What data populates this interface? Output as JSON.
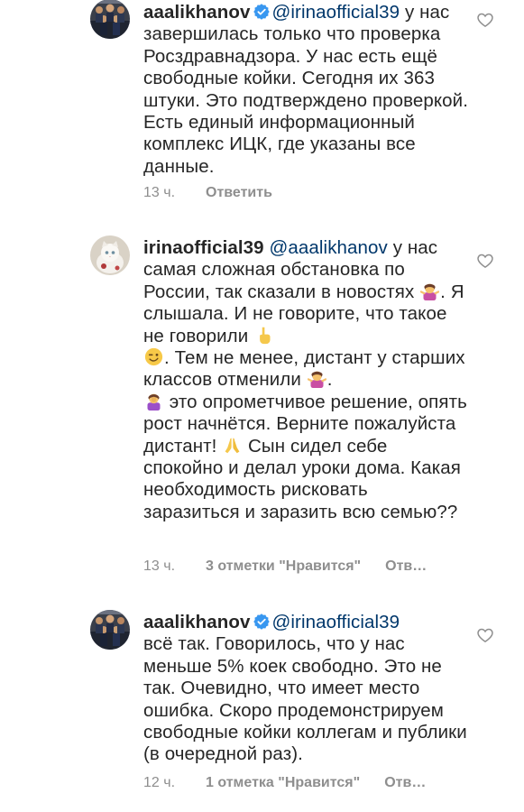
{
  "comments": [
    {
      "username": "aaalikhanov",
      "verified": true,
      "mention": "@irinaofficial39",
      "text_1": " у нас завершилась только что проверка Росздравнадзора. У нас есть ещё свободные койки. Сегодня их 363 штуки. Это подтверждено проверкой. Есть единый информационный комплекс ИЦК, где указаны все данные.",
      "time": "13 ч.",
      "likes": "",
      "reply": "Ответить",
      "avatar_icon": "avatar-group-photo",
      "like_icon": "heart-outline-icon"
    },
    {
      "username": "irinaofficial39",
      "verified": false,
      "mention": "@aaalikhanov",
      "text_1": " у нас самая сложная обстановка по России, так сказали в новостях ",
      "text_2": ". Я слышала. И не говорите, что такое не говорили ",
      "text_3": ". Тем не менее, дистант у старших классов отменили ",
      "text_4": ". ",
      "text_5": " это опрометчивое решение, опять рост начнётся.  Верните пожалуйста дистант! ",
      "text_6": "  Сын сидел себе спокойно и делал уроки дома. Какая необходимость рисковать заразиться и заразить всю семью??",
      "time": "13 ч.",
      "likes": "3 отметки \"Нравится\"",
      "reply": "Отв…",
      "avatar_icon": "avatar-white-cat",
      "like_icon": "heart-outline-icon",
      "emoji_icons": [
        "woman-shrugging-emoji",
        "pointing-up-emoji",
        "winking-face-emoji",
        "woman-shrugging-emoji",
        "woman-facepalming-emoji",
        "folded-hands-emoji"
      ]
    },
    {
      "username": "aaalikhanov",
      "verified": true,
      "mention": "@irinaofficial39",
      "text_1": "всё так. Говорилось, что у нас меньше 5% коек свободно. Это не так. Очевидно, что имеет место ошибка. Скоро продемонстрируем свободные койки коллегам и публики (в очередной раз).",
      "time": "12 ч.",
      "likes": "1 отметка \"Нравится\"",
      "reply": "Отв…",
      "avatar_icon": "avatar-group-photo",
      "like_icon": "heart-outline-icon"
    }
  ],
  "colors": {
    "text": "#262626",
    "mention": "#00376b",
    "meta": "#8e8e8e",
    "verified": "#3897f0"
  }
}
